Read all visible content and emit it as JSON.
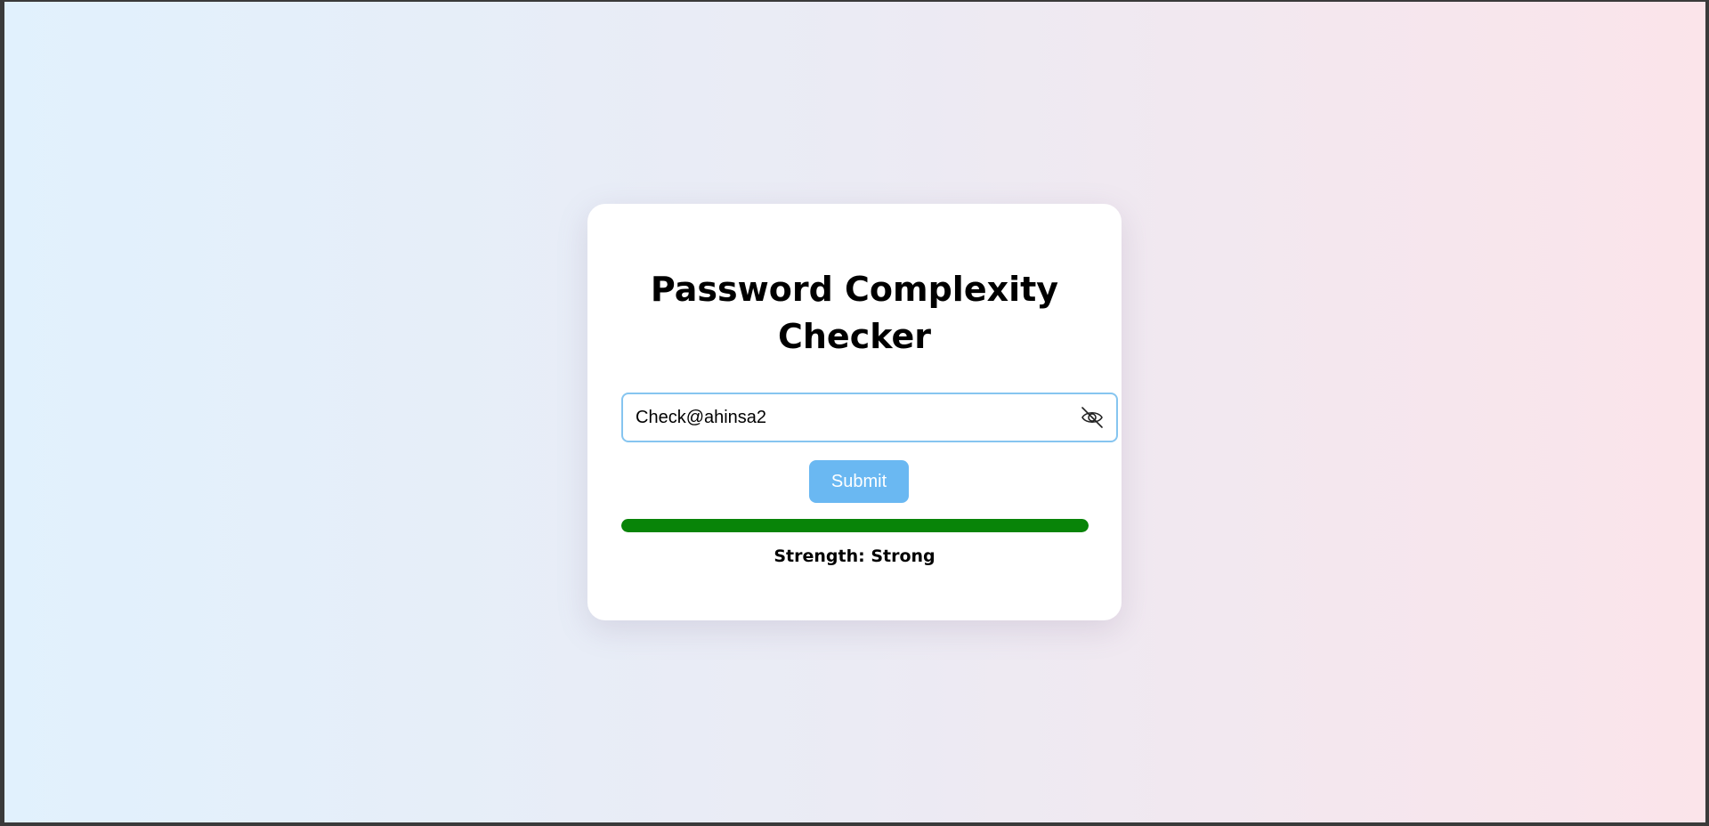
{
  "card": {
    "title_line1": "Password Complexity",
    "title_line2": "Checker"
  },
  "password": {
    "value": "Check@ahinsa2",
    "visibility_icon": "eye-off-icon"
  },
  "submit": {
    "label": "Submit"
  },
  "strength": {
    "prefix": "Strength:",
    "level": "Strong",
    "progress": 1.0,
    "color": "#088408"
  },
  "colors": {
    "accent": "#6ab8f2",
    "field_border": "#86c5f0",
    "strong": "#088408"
  }
}
